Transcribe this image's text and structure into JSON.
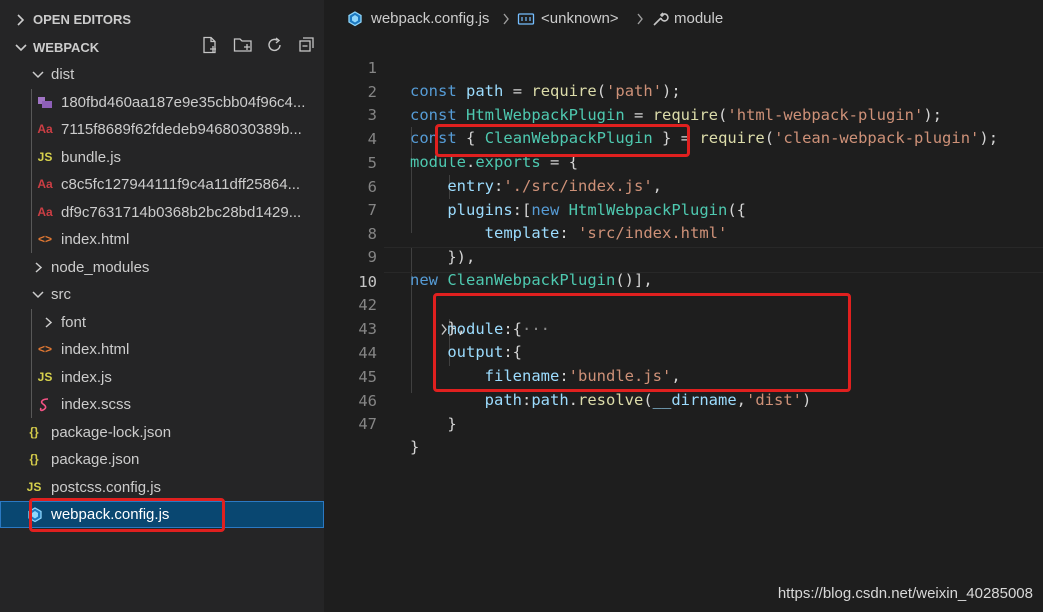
{
  "sidebar": {
    "open_editors_label": "OPEN EDITORS",
    "project_label": "WEBPACK",
    "tree": [
      {
        "label": "dist"
      },
      {
        "label": "180fbd460aa187e9e35cbb04f96c4..."
      },
      {
        "label": "7115f8689f62fdedeb9468030389b..."
      },
      {
        "label": "bundle.js"
      },
      {
        "label": "c8c5fc127944111f9c4a11dff25864..."
      },
      {
        "label": "df9c7631714b0368b2bc28bd1429..."
      },
      {
        "label": "index.html"
      },
      {
        "label": "node_modules"
      },
      {
        "label": "src"
      },
      {
        "label": "font"
      },
      {
        "label": "index.html"
      },
      {
        "label": "index.js"
      },
      {
        "label": "index.scss"
      },
      {
        "label": "package-lock.json"
      },
      {
        "label": "package.json"
      },
      {
        "label": "postcss.config.js"
      },
      {
        "label": "webpack.config.js"
      }
    ]
  },
  "breadcrumb": {
    "file": "webpack.config.js",
    "symbol": "<unknown>",
    "member": "module"
  },
  "editor": {
    "line_numbers": [
      "1",
      "2",
      "3",
      "4",
      "5",
      "6",
      "7",
      "8",
      "9",
      "10",
      "42",
      "43",
      "44",
      "45",
      "46",
      "47"
    ],
    "lines": [
      "const path = require('path');",
      "const HtmlWebpackPlugin = require('html-webpack-plugin');",
      "const { CleanWebpackPlugin } = require('clean-webpack-plugin');",
      "module.exports = {",
      "    entry:'./src/index.js',",
      "    plugins:[new HtmlWebpackPlugin({",
      "        template: 'src/index.html'",
      "    }),",
      "new CleanWebpackPlugin()],",
      "    module:{···",
      "    },",
      "    output:{",
      "        filename:'bundle.js',",
      "        path:path.resolve(__dirname,'dist')",
      "    }",
      "}"
    ]
  },
  "watermark": "https://blog.csdn.net/weixin_40285008",
  "colors": {
    "highlight_box": "#e0201f",
    "selection": "#094771",
    "editor_bg": "#1e1e1e",
    "sidebar_bg": "#252526"
  }
}
